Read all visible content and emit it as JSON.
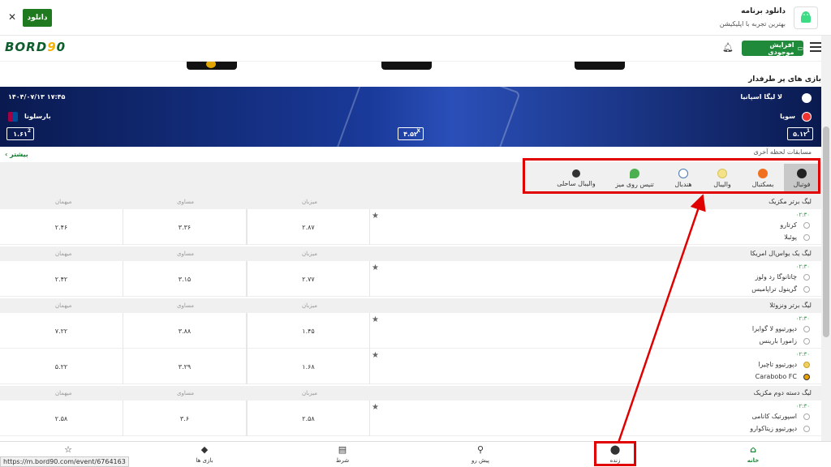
{
  "banner": {
    "close": "✕",
    "download_button": "دانلود",
    "title": "دانلود برنامه",
    "subtitle": "بهترین تجربه با اپلیکیشن"
  },
  "header": {
    "logo_a": "BORD",
    "logo_b": "9",
    "logo_c": "0",
    "deposit_button": "افزایش موجودی"
  },
  "fav_games_title": "بازی های پر طرفدار",
  "featured": {
    "league": "لا لیگا اسپانیا",
    "datetime": "۱۴۰۴/۰۷/۱۳ ۱۷:۴۵",
    "home_team": "سویا",
    "away_team": "بارسلونا",
    "odds": [
      {
        "label": "1",
        "value": "۵.۱۲"
      },
      {
        "label": "X",
        "value": "۴.۵۲"
      },
      {
        "label": "2",
        "value": "۱.۶۱"
      }
    ]
  },
  "more_link": "بیشتر",
  "upcoming_label": "مسابقات لحظه آخری",
  "sport_tabs": [
    {
      "label": "فوتبال",
      "active": true
    },
    {
      "label": "بسکتبال",
      "active": false
    },
    {
      "label": "والیبال",
      "active": false
    },
    {
      "label": "هندبال",
      "active": false
    },
    {
      "label": "تنیس روی میز",
      "active": false
    },
    {
      "label": "والیبال ساحلی",
      "active": false
    }
  ],
  "columns": {
    "home": "میزبان",
    "draw": "مساوی",
    "away": "میهمان"
  },
  "leagues": [
    {
      "name": "لیگ برتر مکزیک",
      "matches": [
        {
          "time": "۰۲:۳۰",
          "home": "کرتارو",
          "away": "پوئبلا",
          "odds": [
            "۲.۸۷",
            "۳.۳۶",
            "۲.۴۶"
          ]
        }
      ]
    },
    {
      "name": "لیگ یک یواس‌ال امریکا",
      "matches": [
        {
          "time": "۰۲:۳۰",
          "home": "چاتانوگا رد ولوز",
          "away": "گرینول تراپامیس",
          "odds": [
            "۲.۷۷",
            "۳.۱۵",
            "۲.۴۲"
          ]
        }
      ]
    },
    {
      "name": "لیگ برتر ونزوئلا",
      "matches": [
        {
          "time": "۰۲:۳۰",
          "home": "دپورتیوو لا گوایرا",
          "away": "زامورا بارینس",
          "odds": [
            "۱.۴۵",
            "۳.۸۸",
            "۷.۲۲"
          ]
        },
        {
          "time": "۰۲:۳۰",
          "home": "دپورتیوو تاچیرا",
          "away": "Carabobo FC",
          "odds": [
            "۱.۶۸",
            "۳.۲۹",
            "۵.۲۲"
          ]
        }
      ]
    },
    {
      "name": "لیگ دسته دوم مکزیک",
      "matches": [
        {
          "time": "۰۲:۳۰",
          "home": "اسپورتیک کانامی",
          "away": "دپورتیوو زیتاکوارو",
          "odds": [
            "۲.۵۸",
            "۳.۶",
            "۲.۵۸"
          ]
        }
      ]
    }
  ],
  "bottom_nav": [
    {
      "label": "",
      "icon": "star-icon"
    },
    {
      "label": "بازی ها",
      "icon": "cube-icon"
    },
    {
      "label": "شرط",
      "icon": "ticket-icon"
    },
    {
      "label": "پیش رو",
      "icon": "bike-icon"
    },
    {
      "label": "زنده",
      "icon": "live-dot-icon"
    },
    {
      "label": "خانه",
      "icon": "home-icon",
      "active": true
    }
  ],
  "status_url": "https://m.bord90.com/event/6764163",
  "colors": {
    "brand_green": "#1f8a3a",
    "highlight_red": "#e00000",
    "hero_blue": "#0a1a50"
  }
}
